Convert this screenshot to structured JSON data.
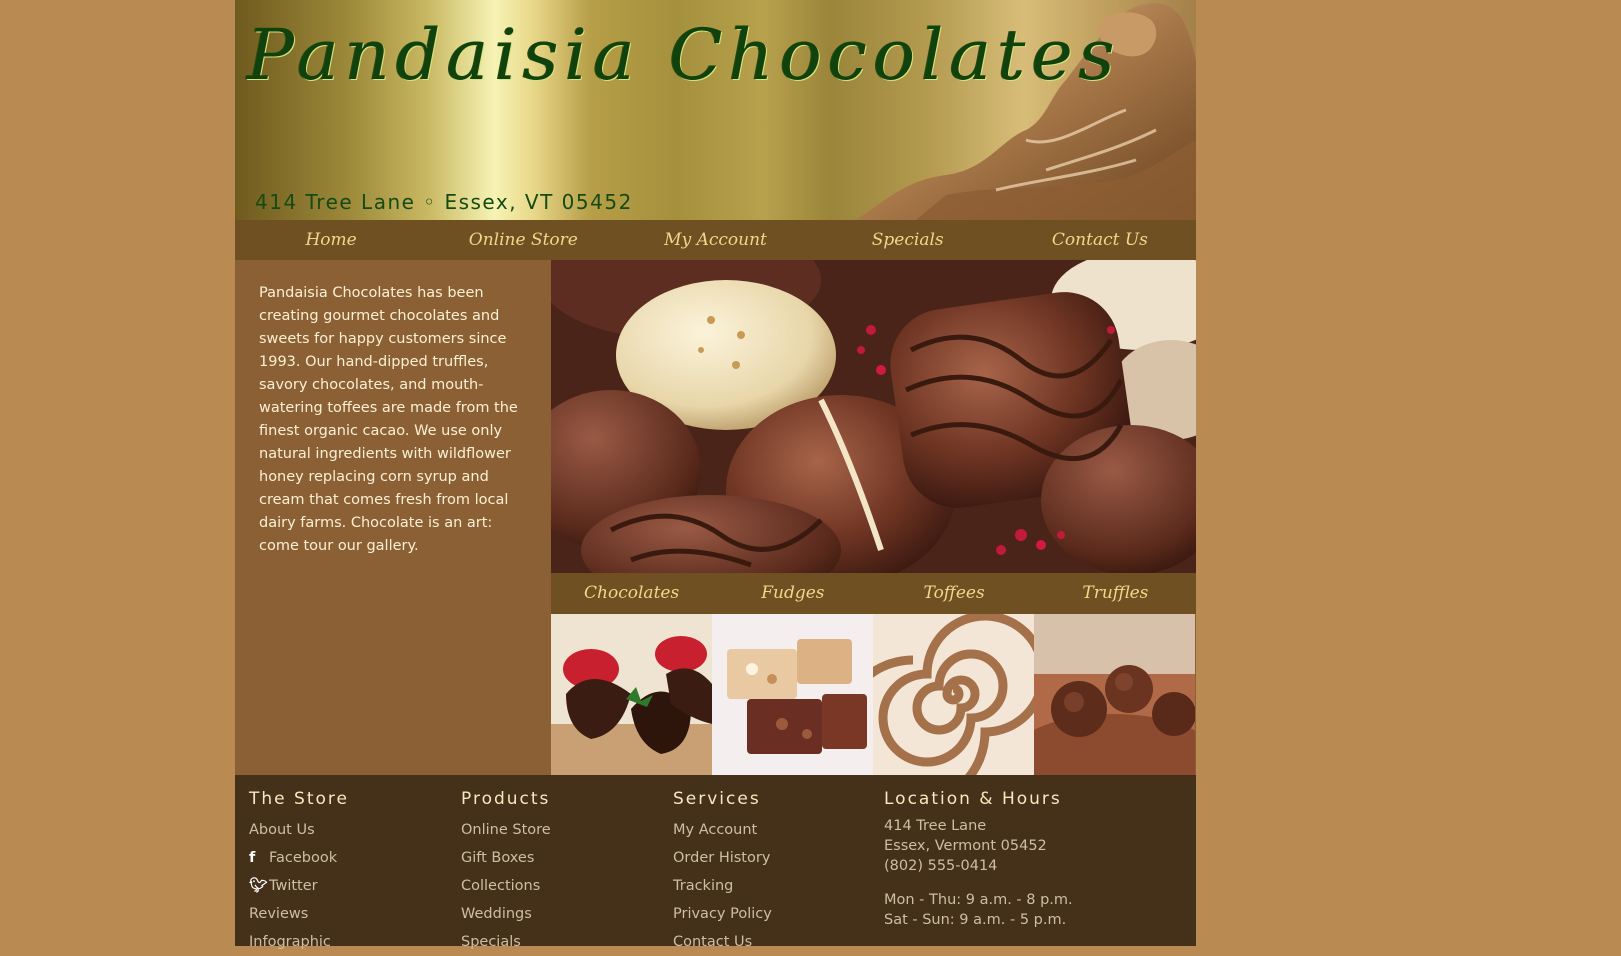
{
  "header": {
    "title": "Pandaisia Chocolates",
    "address": "414 Tree Lane ◦ Essex, VT 05452"
  },
  "main_nav": {
    "items": [
      "Home",
      "Online Store",
      "My Account",
      "Specials",
      "Contact Us"
    ]
  },
  "intro": {
    "text": "Pandaisia Chocolates has been creating gourmet chocolates and sweets for happy customers since 1993. Our hand-dipped truffles, savory chocolates, and mouth-watering toffees are made from the finest organic cacao. We use only natural ingredients with wildflower honey replacing corn syrup and cream that comes fresh from local dairy farms. Chocolate is an art: come tour our gallery."
  },
  "category_nav": {
    "items": [
      "Chocolates",
      "Fudges",
      "Toffees",
      "Truffles"
    ]
  },
  "footer": {
    "store": {
      "heading": "The Store",
      "links": [
        "About Us",
        "Facebook",
        "Twitter",
        "Reviews",
        "Infographic"
      ]
    },
    "products": {
      "heading": "Products",
      "links": [
        "Online Store",
        "Gift Boxes",
        "Collections",
        "Weddings",
        "Specials"
      ]
    },
    "services": {
      "heading": "Services",
      "links": [
        "My Account",
        "Order History",
        "Tracking",
        "Privacy Policy",
        "Contact Us"
      ]
    },
    "location": {
      "heading": "Location & Hours",
      "street": "414 Tree Lane",
      "city": "Essex, Vermont 05452",
      "phone": "(802) 555-0414",
      "hours_weekday": "Mon - Thu: 9 a.m. - 8 p.m.",
      "hours_weekend": "Sat - Sun: 9 a.m. - 5 p.m."
    }
  },
  "icons": {
    "facebook": "facebook-icon",
    "twitter": "twitter-icon"
  },
  "colors": {
    "page_background": "#b98a52",
    "content_background": "#8c6035",
    "nav_background": "#6e5023",
    "nav_text": "#f2d68a",
    "footer_background": "#45301a",
    "title_green": "#10420e"
  }
}
